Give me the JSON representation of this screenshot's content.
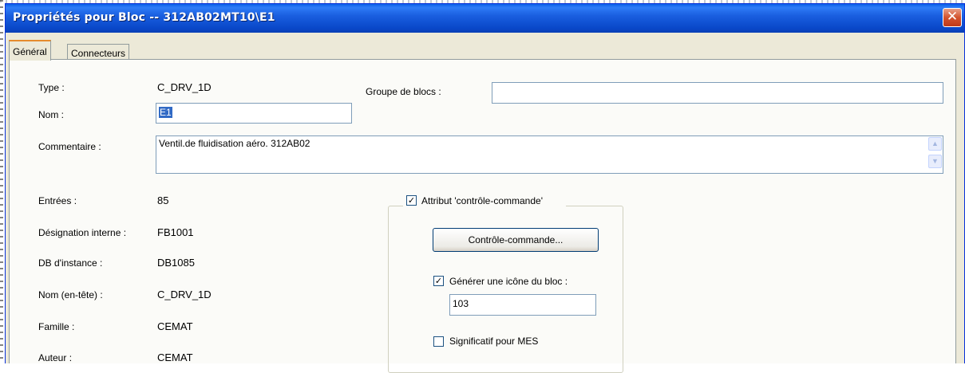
{
  "window": {
    "title": "Propriétés pour Bloc -- 312AB02MT10\\E1",
    "close_glyph": "✕"
  },
  "tabs": [
    {
      "label": "Général",
      "active": true
    },
    {
      "label": "Connecteurs",
      "active": false
    }
  ],
  "general": {
    "type_label": "Type :",
    "type_value": "C_DRV_1D",
    "nom_label": "Nom :",
    "nom_value": "E1",
    "groupe_label": "Groupe de blocs :",
    "groupe_value": "",
    "commentaire_label": "Commentaire :",
    "commentaire_value": "Ventil.de fluidisation aéro. 312AB02",
    "entrees_label": "Entrées :",
    "entrees_value": "85",
    "designation_label": "Désignation interne :",
    "designation_value": "FB1001",
    "db_label": "DB d'instance :",
    "db_value": "DB1085",
    "entete_label": "Nom (en-tête) :",
    "entete_value": "C_DRV_1D",
    "famille_label": "Famille :",
    "famille_value": "CEMAT",
    "auteur_label": "Auteur :",
    "auteur_value": "CEMAT"
  },
  "controle_group": {
    "attribut_label": "Attribut 'contrôle-commande'",
    "attribut_checked": true,
    "button_label": "Contrôle-commande...",
    "icone_label": "Générer une icône du bloc :",
    "icone_checked": true,
    "icone_value": "103",
    "mes_label": "Significatif pour MES",
    "mes_checked": false
  },
  "colors": {
    "titlebar": "#0A5FE8",
    "dialog_bg": "#ECE9D8",
    "selection": "#316AC5",
    "close": "#D3532E"
  }
}
